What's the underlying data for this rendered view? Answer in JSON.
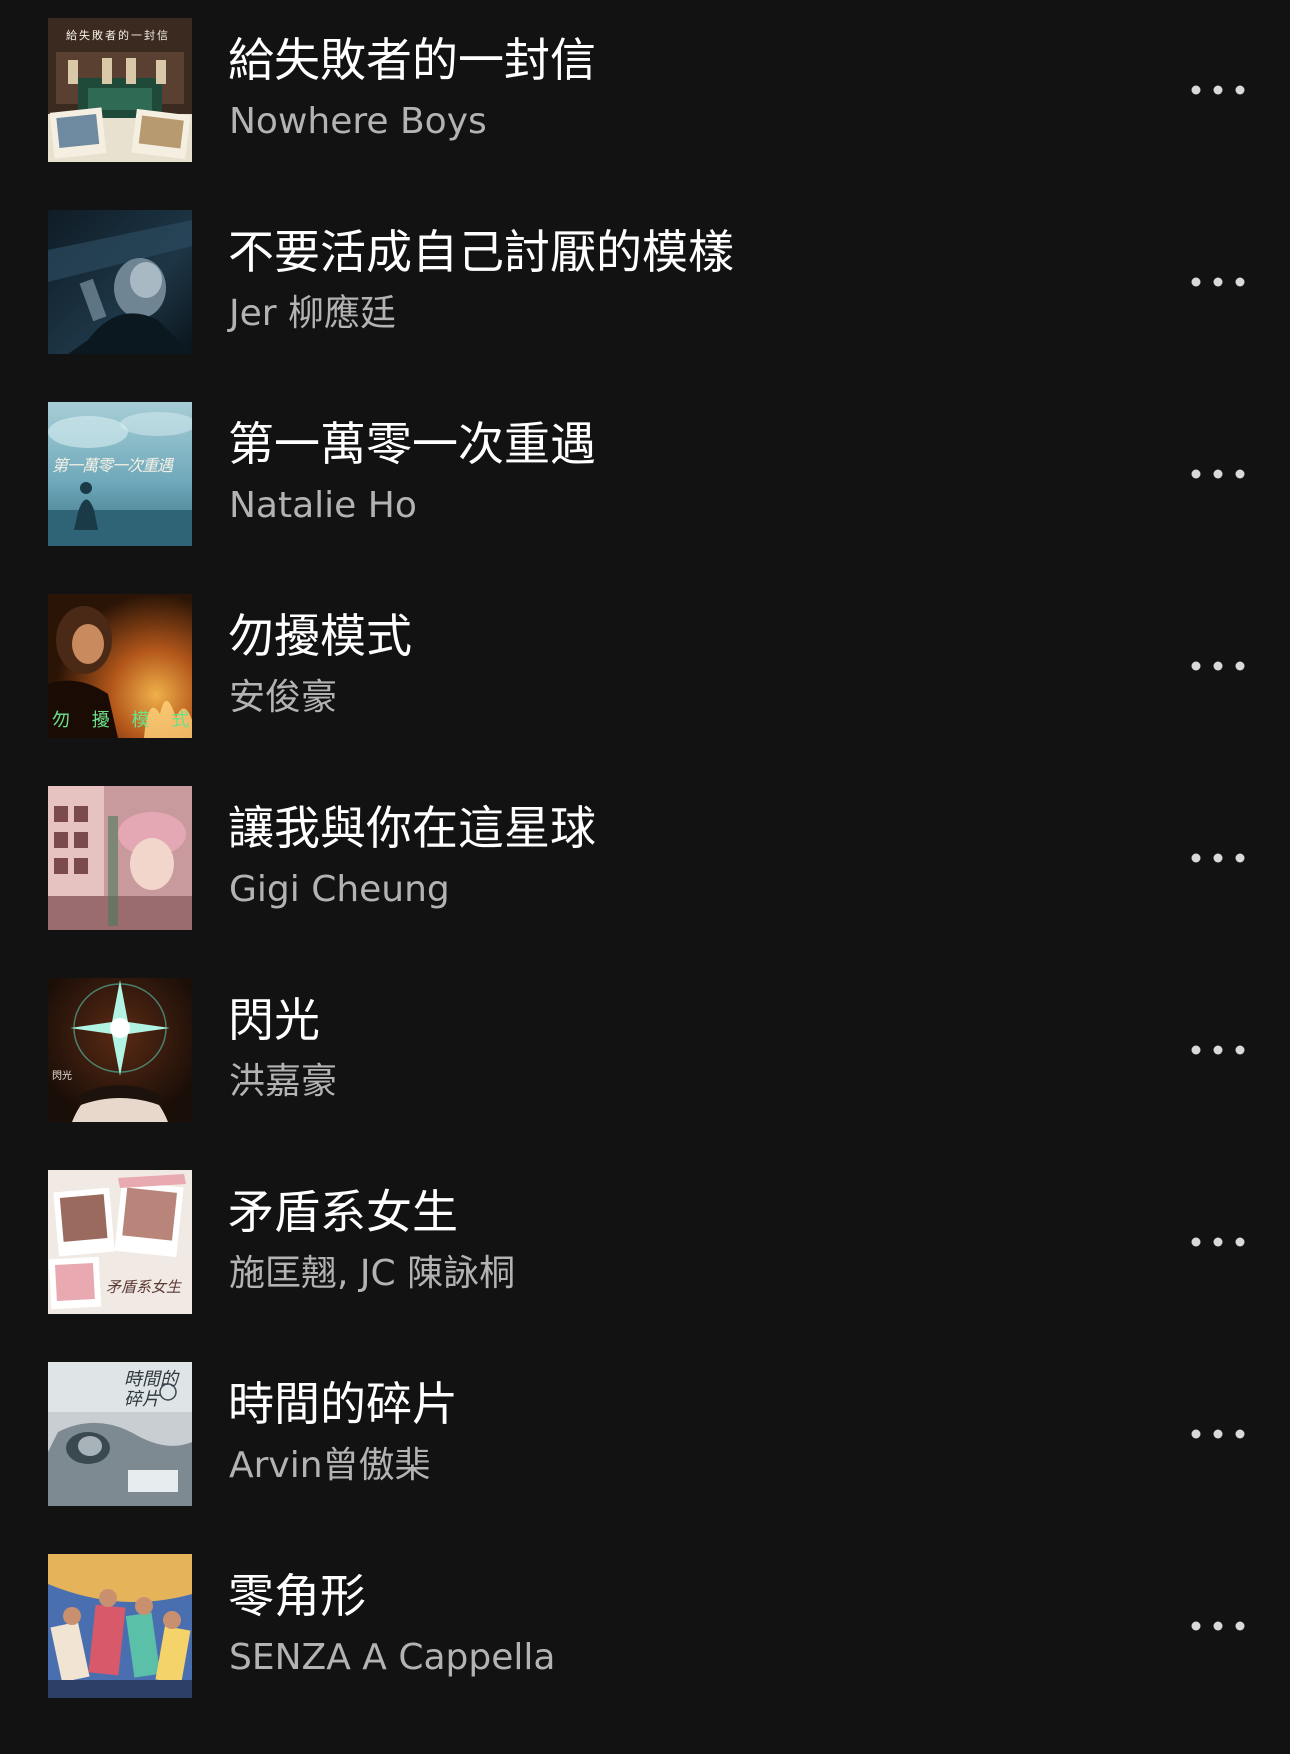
{
  "tracks": [
    {
      "title": "給失敗者的一封信",
      "artist": "Nowhere Boys",
      "cover_icon": "album-cover-band-stage",
      "cover_text": "給失敗者的一封信",
      "cover_colors": [
        "#3b2a20",
        "#1f4a3a",
        "#d9c9a8"
      ]
    },
    {
      "title": "不要活成自己討厭的模樣",
      "artist": "Jer 柳應廷",
      "cover_icon": "album-cover-man-in-car",
      "cover_text": "",
      "cover_colors": [
        "#0f1c26",
        "#2b4a5e",
        "#8aa3b3"
      ]
    },
    {
      "title": "第一萬零一次重遇",
      "artist": "Natalie Ho",
      "cover_icon": "album-cover-sky-figure",
      "cover_text": "第一萬零一次重遇",
      "cover_colors": [
        "#6fa9bb",
        "#a7cdd6",
        "#3b6f82"
      ]
    },
    {
      "title": "勿擾模式",
      "artist": "安俊豪",
      "cover_icon": "album-cover-fire-portrait",
      "cover_text": "勿 擾 模 式",
      "cover_colors": [
        "#2a1406",
        "#b2561a",
        "#f0b04a"
      ]
    },
    {
      "title": "讓我與你在這星球",
      "artist": "Gigi Cheung",
      "cover_icon": "album-cover-city-portrait",
      "cover_text": "",
      "cover_colors": [
        "#c89a9e",
        "#e6c3c0",
        "#7b4a4e"
      ]
    },
    {
      "title": "閃光",
      "artist": "洪嘉豪",
      "cover_icon": "album-cover-sparkle-light",
      "cover_text": "閃光",
      "cover_colors": [
        "#1a0e08",
        "#5a2a14",
        "#b7fff0"
      ]
    },
    {
      "title": "矛盾系女生",
      "artist": "施匡翹, JC 陳詠桐",
      "cover_icon": "album-cover-photo-collage",
      "cover_text": "矛盾系女生",
      "cover_colors": [
        "#f1e9e3",
        "#e8a9b0",
        "#9b6a5f"
      ]
    },
    {
      "title": "時間的碎片",
      "artist": "Arvin曾傲棐",
      "cover_icon": "album-cover-sketch-sleeper",
      "cover_text": "時間的碎片",
      "cover_colors": [
        "#c8ced2",
        "#7d8a92",
        "#3a4850"
      ]
    },
    {
      "title": "零角形",
      "artist": "SENZA A Cappella",
      "cover_icon": "album-cover-group-collage",
      "cover_text": "",
      "cover_colors": [
        "#4a6fb0",
        "#e4b35a",
        "#d85a6a"
      ]
    }
  ],
  "more_icon": "more-options-icon",
  "ghost_text": "",
  "colors": {
    "background": "#121212",
    "title": "#ffffff",
    "artist": "#b3b3b3",
    "more_dots": "#d9d9d9"
  }
}
